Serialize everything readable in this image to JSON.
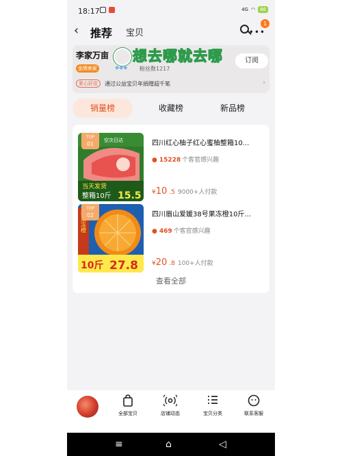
{
  "status": {
    "time": "18:17",
    "signal": "4G",
    "battery": "86"
  },
  "nav": {
    "back": "‹",
    "title": "推荐",
    "subtitle": "宝贝",
    "badge_count": "1"
  },
  "shop": {
    "name": "李家万亩",
    "overlay_text": "想去哪就去哪",
    "gold_badge": "金牌卖家",
    "fans": "粉丝数1217",
    "subscribe": "订阅",
    "love_tag": "爱心好店",
    "love_text": "通过公益宝贝年捐赠超千笔"
  },
  "tabs": [
    {
      "label": "销量榜",
      "active": true
    },
    {
      "label": "收藏榜",
      "active": false
    },
    {
      "label": "新品榜",
      "active": false
    }
  ],
  "items": [
    {
      "rank_top": "TOP",
      "rank_num": "01",
      "name": "四川红心柚子红心蜜柚整箱10...",
      "interest_count": "15228",
      "interest_label": "个客官感兴趣",
      "price_prefix": "¥",
      "price_int": "10",
      "price_dec": ".5",
      "sales": "9000+人付款",
      "img_banner": "空次日达",
      "img_line1": "当天发货",
      "img_line2": "整箱10斤",
      "img_price": "15.5"
    },
    {
      "rank_top": "TOP",
      "rank_num": "02",
      "name": "四川眉山爱媛38号果冻橙10斤...",
      "interest_count": "469",
      "interest_label": "个客官感兴趣",
      "price_prefix": "¥",
      "price_int": "20",
      "price_dec": ".8",
      "sales": "100+人付款",
      "img_side": "爱媛果冻橙",
      "img_line": "10斤",
      "img_price": "27.8"
    }
  ],
  "view_all": "查看全部",
  "bottom_nav": [
    {
      "label": "全部宝贝",
      "icon": "bag-icon"
    },
    {
      "label": "店铺动态",
      "icon": "broadcast-icon"
    },
    {
      "label": "宝贝分类",
      "icon": "list-icon"
    },
    {
      "label": "联系客服",
      "icon": "chat-icon"
    }
  ],
  "colors": {
    "accent": "#e05020",
    "page_bg": "#f3f2f4"
  }
}
